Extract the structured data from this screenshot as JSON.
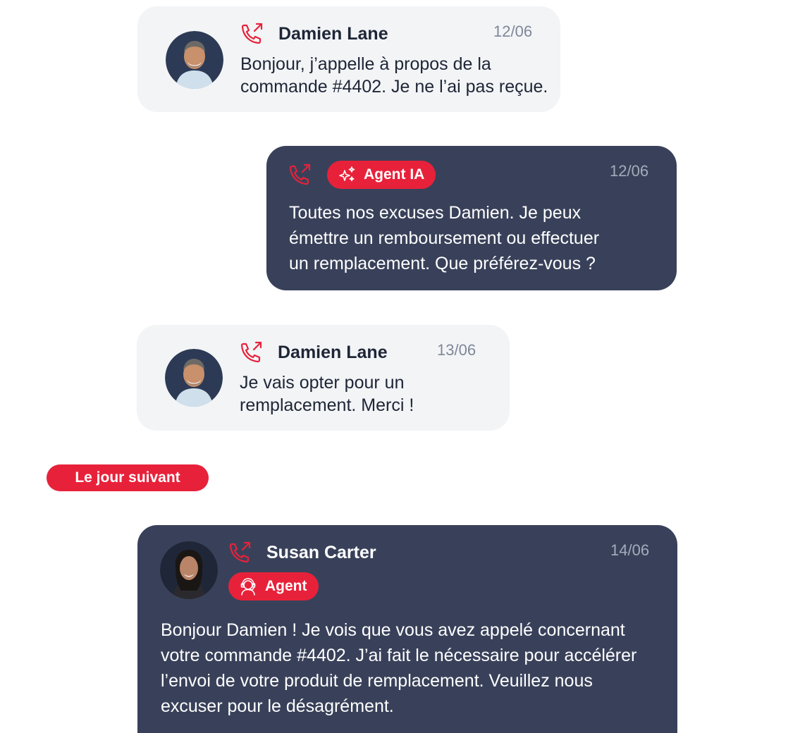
{
  "colors": {
    "accent": "#e8213a",
    "dark_bubble": "#39415a",
    "light_bubble": "#f2f4f6",
    "text_dark": "#1e2536",
    "date_gray": "#7f8798"
  },
  "messages": [
    {
      "sender": "Damien Lane",
      "date": "12/06",
      "icon": "phone-call-outgoing-icon",
      "avatar": "damien-avatar",
      "line1": "Bonjour, j’appelle à propos de la",
      "line2": "commande #4402. Je ne l’ai pas reçue."
    },
    {
      "badge": "Agent IA",
      "badge_icon": "sparkles-icon",
      "date": "12/06",
      "icon": "phone-call-outgoing-icon",
      "line1": "Toutes nos excuses Damien. Je peux",
      "line2": "émettre un remboursement ou effectuer",
      "line3": "un remplacement. Que préférez-vous ?"
    },
    {
      "sender": "Damien Lane",
      "date": "13/06",
      "icon": "phone-call-outgoing-icon",
      "avatar": "damien-avatar",
      "line1": "Je vais opter pour un",
      "line2": "remplacement. Merci !"
    },
    {
      "sender": "Susan Carter",
      "date": "14/06",
      "badge": "Agent",
      "badge_icon": "headset-agent-icon",
      "icon": "phone-call-outgoing-icon",
      "avatar": "susan-avatar",
      "line1": "Bonjour Damien ! Je vois que vous avez appelé concernant",
      "line2": "votre commande #4402. J’ai fait le nécessaire pour accélérer",
      "line3": "l’envoi de votre produit de remplacement. Veuillez nous",
      "line4": "excuser pour le désagrément."
    }
  ],
  "divider": {
    "label": "Le jour suivant"
  }
}
